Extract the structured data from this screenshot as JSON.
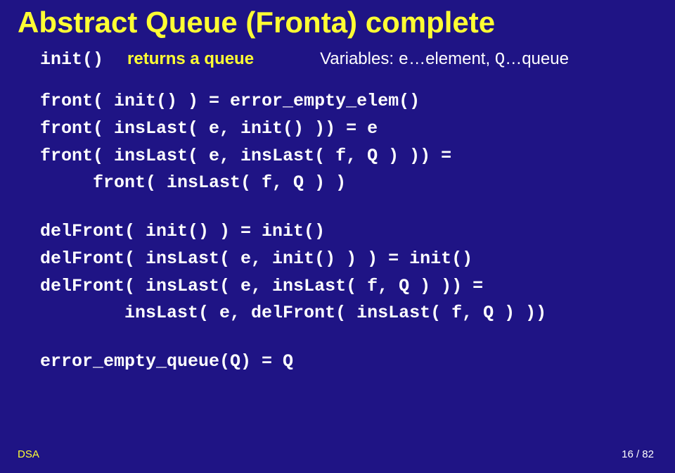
{
  "title": "Abstract Queue (Fronta) complete",
  "line1": {
    "init": "init()",
    "returns": "returns a queue",
    "variables_label": "Variables: ",
    "variables_e": "e",
    "variables_elem": "…element, ",
    "variables_Q": "Q",
    "variables_queue": "…queue"
  },
  "block1": "front( init() ) = error_empty_elem()\nfront( insLast( e, init() )) = e\nfront( insLast( e, insLast( f, Q ) )) =\n     front( insLast( f, Q ) )",
  "block2": "delFront( init() ) = init()\ndelFront( insLast( e, init() ) ) = init()\ndelFront( insLast( e, insLast( f, Q ) )) =\n        insLast( e, delFront( insLast( f, Q ) ))",
  "block3": "error_empty_queue(Q) = Q",
  "footer": {
    "left": "DSA",
    "right": "16 / 82"
  }
}
